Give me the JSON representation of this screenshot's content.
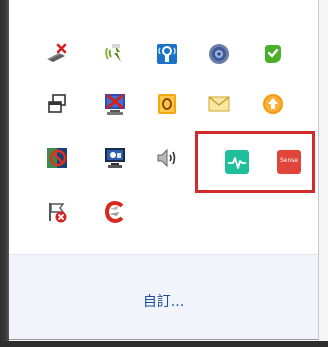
{
  "tray": {
    "icons": [
      {
        "name": "network-disconnected-icon"
      },
      {
        "name": "wifi-manager-icon"
      },
      {
        "name": "wireless-connection-icon"
      },
      {
        "name": "media-disc-icon"
      },
      {
        "name": "green-app-icon"
      },
      {
        "name": "task-manager-icon"
      },
      {
        "name": "display-disabled-icon"
      },
      {
        "name": "office-app-icon"
      },
      {
        "name": "mail-icon"
      },
      {
        "name": "update-arrow-icon"
      },
      {
        "name": "network-blocked-icon"
      },
      {
        "name": "display-settings-icon"
      },
      {
        "name": "volume-icon"
      },
      {
        "name": "activity-monitor-icon"
      },
      {
        "name": "sense-app-icon",
        "label": "Sense"
      },
      {
        "name": "action-center-error-icon"
      },
      {
        "name": "ccleaner-icon"
      }
    ],
    "highlight_color": "#d12b2b"
  },
  "footer": {
    "customize_label": "自訂..."
  }
}
